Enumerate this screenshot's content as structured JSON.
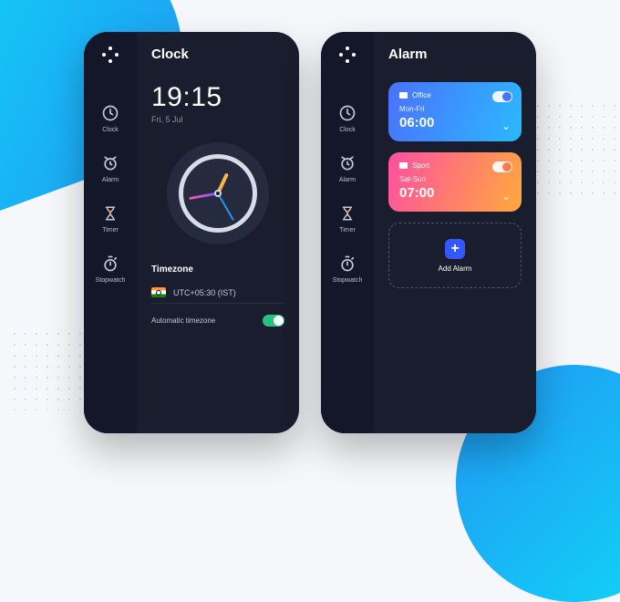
{
  "clockScreen": {
    "title": "Clock",
    "time": "19:15",
    "date": "Fri, 5 Jul",
    "timezoneSection": "Timezone",
    "timezone": "UTC+05:30 (IST)",
    "autoLabel": "Automatic timezone",
    "autoOn": true
  },
  "alarmScreen": {
    "title": "Alarm",
    "alarms": [
      {
        "tag": "Office",
        "days": "Mon-Fri",
        "time": "06:00",
        "on": true
      },
      {
        "tag": "Sport",
        "days": "Sat-Sun",
        "time": "07:00",
        "on": true
      }
    ],
    "addLabel": "Add Alarm"
  },
  "rail": {
    "items": [
      {
        "label": "Clock"
      },
      {
        "label": "Alarm"
      },
      {
        "label": "Timer"
      },
      {
        "label": "Stopwatch"
      }
    ]
  }
}
